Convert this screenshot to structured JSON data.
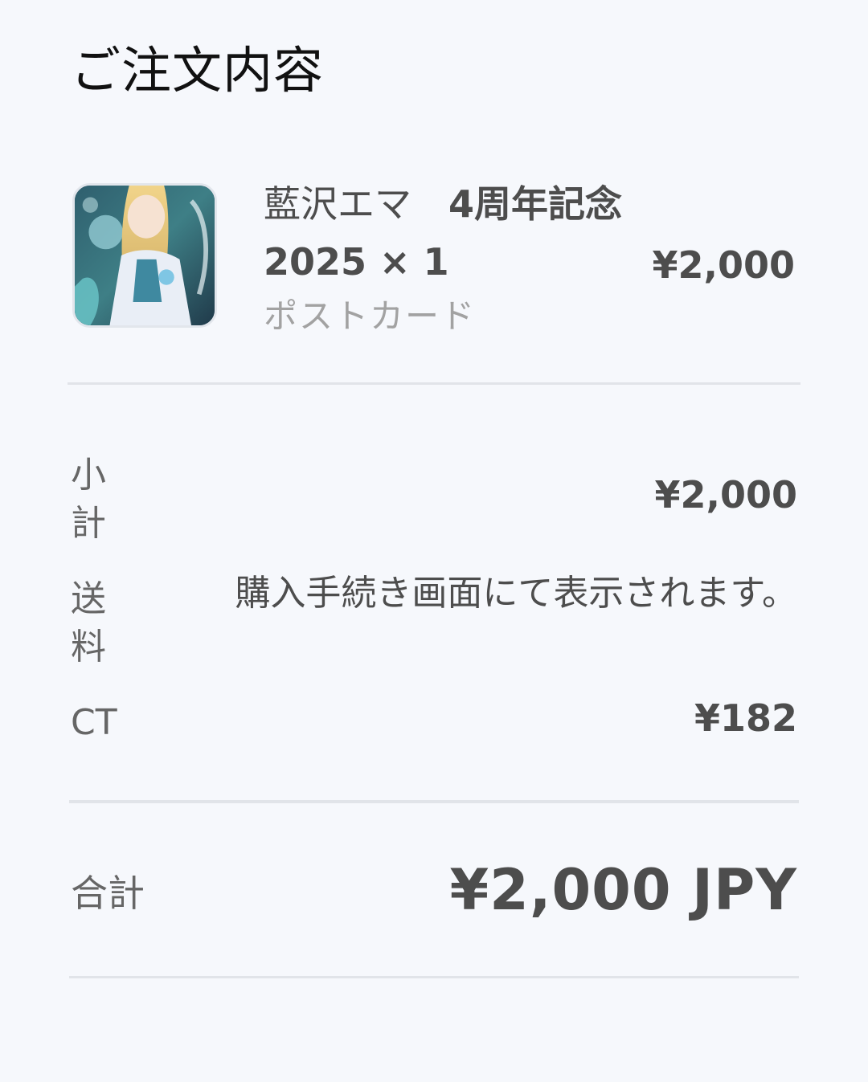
{
  "header": {
    "title": "ご注文内容"
  },
  "item": {
    "name": "藍沢エマ　",
    "name_bold": "4周年記念2025 × 1",
    "variant": "ポストカード",
    "price": "¥2,000",
    "thumbnail_icon": "product-thumbnail"
  },
  "summary": {
    "subtotal_label": "小計",
    "subtotal_value": "¥2,000",
    "shipping_label": "送料",
    "shipping_value": "購入手続き画面にて表示されます。",
    "ct_label": "CT",
    "ct_value": "¥182"
  },
  "total": {
    "label": "合計",
    "value": "¥2,000 JPY"
  }
}
